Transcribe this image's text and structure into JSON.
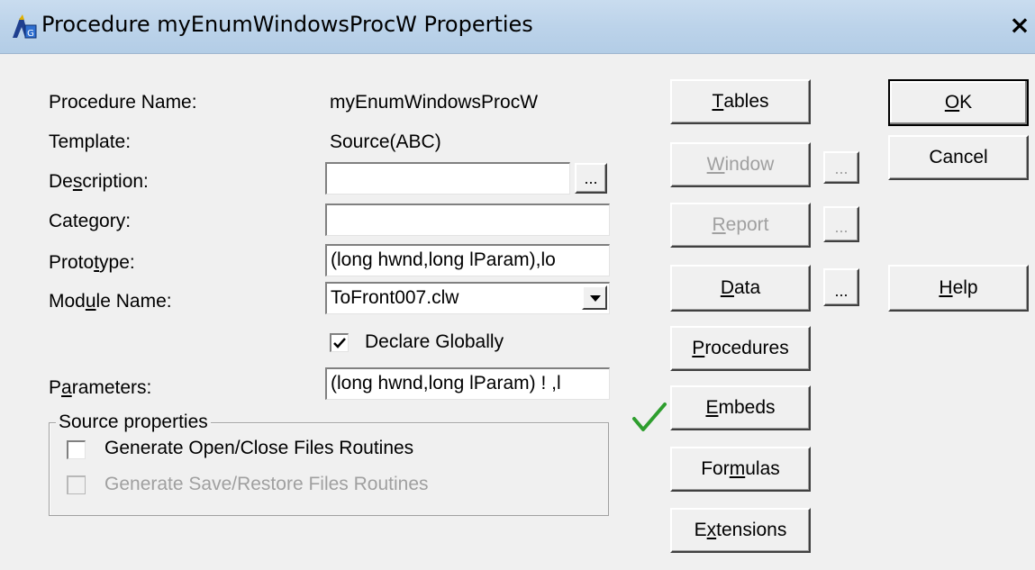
{
  "window": {
    "title": "Procedure myEnumWindowsProcW Properties",
    "close_glyph": "×"
  },
  "form": {
    "procedure_name_label": "Procedure Name:",
    "procedure_name_value": "myEnumWindowsProcW",
    "template_label": "Template:",
    "template_value": "Source(ABC)",
    "description_label_pre": "De",
    "description_label_u": "s",
    "description_label_post": "cription:",
    "description_value": "",
    "category_label": "Category:",
    "category_value": "",
    "prototype_label_pre": "Proto",
    "prototype_label_u": "t",
    "prototype_label_post": "ype:",
    "prototype_value": "(long hwnd,long lParam),lo",
    "module_label_pre": "Mod",
    "module_label_u": "u",
    "module_label_post": "le Name:",
    "module_value": "ToFront007.clw",
    "declare_globally_label": "Declare Globally",
    "declare_globally_checked": true,
    "parameters_label_pre": "P",
    "parameters_label_u": "a",
    "parameters_label_post": "rameters:",
    "parameters_value": "(long hwnd,long lParam) ! ,l"
  },
  "source_properties": {
    "title": "Source properties",
    "generate_open_close": "Generate Open/Close Files Routines",
    "generate_save_restore": "Generate Save/Restore Files Routines"
  },
  "buttons": {
    "tables": {
      "u": "T",
      "rest": "ables"
    },
    "window": {
      "u": "W",
      "rest": "indow"
    },
    "report": {
      "u": "R",
      "rest": "eport"
    },
    "data": {
      "u": "D",
      "rest": "ata"
    },
    "procedures": {
      "u": "P",
      "rest": "rocedures"
    },
    "embeds": {
      "u": "E",
      "rest": "mbeds"
    },
    "formulas": {
      "pre": "For",
      "u": "m",
      "rest": "ulas"
    },
    "extensions": {
      "pre": "E",
      "u": "x",
      "rest": "tensions"
    },
    "ok": {
      "u": "O",
      "rest": "K"
    },
    "cancel": "Cancel",
    "help": {
      "u": "H",
      "rest": "elp"
    },
    "ellipsis": "..."
  },
  "colors": {
    "titlebar": "#bcd3ea",
    "dialog_bg": "#f0f0f0",
    "disabled_text": "#a0a0a0",
    "checkmark_green": "#2e9e2e"
  },
  "icons": {
    "title_icon": "procedure-icon",
    "embeds_status": "green-checkmark-icon"
  }
}
